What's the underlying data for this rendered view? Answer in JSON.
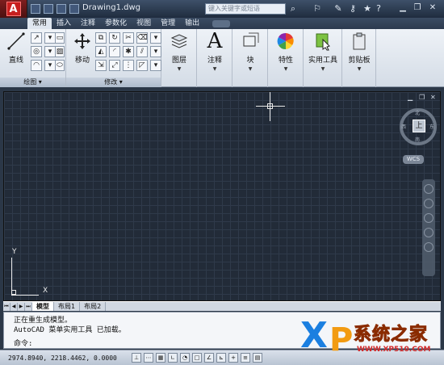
{
  "titlebar": {
    "app_logo": "A",
    "document_title": "Drawing1.dwg",
    "search_placeholder": "键入关键字或短语"
  },
  "ribbon": {
    "tabs": [
      {
        "label": "常用",
        "active": true
      },
      {
        "label": "插入",
        "active": false
      },
      {
        "label": "注释",
        "active": false
      },
      {
        "label": "参数化",
        "active": false
      },
      {
        "label": "视图",
        "active": false
      },
      {
        "label": "管理",
        "active": false
      },
      {
        "label": "输出",
        "active": false
      }
    ],
    "panels": {
      "draw": {
        "title": "绘图",
        "line_label": "直线"
      },
      "modify": {
        "title": "修改",
        "move_label": "移动"
      },
      "layers": {
        "label": "图层"
      },
      "annotation": {
        "label": "注释",
        "icon_glyph": "A"
      },
      "block": {
        "label": "块"
      },
      "properties": {
        "label": "特性"
      },
      "utilities": {
        "label": "实用工具"
      },
      "clipboard": {
        "label": "剪贴板"
      }
    }
  },
  "viewport": {
    "viewcube_face": "上",
    "compass": {
      "north": "北",
      "south": "南",
      "east": "东",
      "west": "西"
    },
    "wcs_label": "WCS",
    "ucs_x": "X",
    "ucs_y": "Y"
  },
  "layout_tabs": [
    {
      "label": "模型",
      "active": true
    },
    {
      "label": "布局1",
      "active": false
    },
    {
      "label": "布局2",
      "active": false
    }
  ],
  "command_line": {
    "history": [
      "正在重生成模型。",
      "AutoCAD 菜单实用工具 已加载。"
    ],
    "prompt": "命令:"
  },
  "statusbar": {
    "coordinates": "2974.8940, 2218.4462, 0.0000"
  },
  "watermark": {
    "brand_x": "X",
    "brand_p": "P",
    "brand_cn": "系统之家",
    "url": "WWW.XP510.COM"
  },
  "colors": {
    "drawing_background": "#222b38",
    "grid_line": "#2f3a4a",
    "ribbon_background": "#e3e9f0",
    "app_button": "#c71f1f"
  }
}
